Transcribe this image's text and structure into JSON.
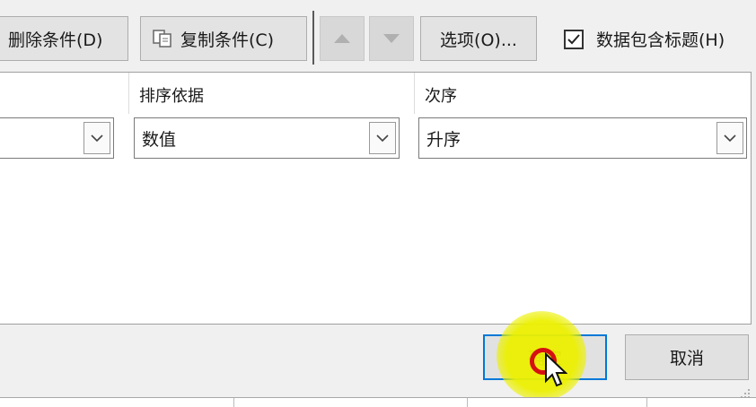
{
  "toolbar": {
    "delete_label": "删除条件(D)",
    "copy_label": "复制条件(C)",
    "options_label": "选项(O)...",
    "has_headers_label": "数据包含标题(H)",
    "has_headers_checked": true
  },
  "table": {
    "headers": {
      "basis": "排序依据",
      "order": "次序"
    },
    "row": {
      "column_value": "",
      "basis_value": "数值",
      "order_value": "升序"
    }
  },
  "footer": {
    "ok_label": "确定",
    "cancel_label": "取消"
  },
  "icons": {
    "copy": "copy-icon",
    "up": "arrow-up-icon",
    "down": "arrow-down-icon",
    "dropdown": "chevron-down-icon",
    "checkbox": "checkmark-icon",
    "cursor": "mouse-pointer-icon"
  }
}
